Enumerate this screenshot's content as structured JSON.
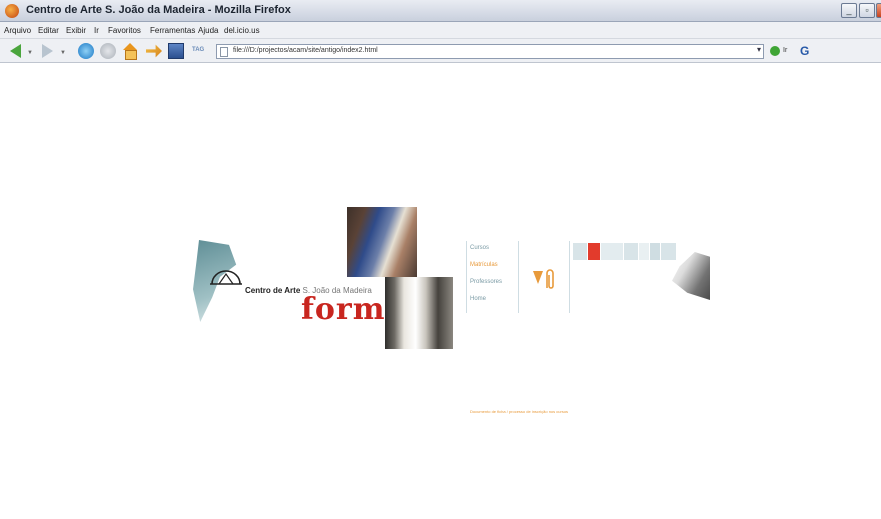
{
  "window": {
    "title": "Centro de Arte S. João da Madeira - Mozilla Firefox"
  },
  "menubar": {
    "items": [
      "Arquivo",
      "Editar",
      "Exibir",
      "Ir",
      "Favoritos",
      "Ferramentas",
      "Ajuda",
      "del.icio.us"
    ]
  },
  "navbar": {
    "tag_label": "TAG",
    "url": "file:///D:/projectos/acam/site/antigo/index2.html",
    "go_label": "Ir"
  },
  "page": {
    "logo_bold": "Centro de Arte",
    "logo_light": "S. João da Madeira",
    "headline": "formac",
    "menu": [
      "Cursos",
      "Matrículas",
      "Professores",
      "Home"
    ],
    "active_menu_index": 1,
    "footer": "Documento de ficha / processo de inscrição nos cursos",
    "colors": {
      "accent_orange": "#e89a3b",
      "accent_red": "#c8261f",
      "menu_teal": "#7a9aa4",
      "strip_light": "#d8e4e8",
      "strip_red": "#e23b2c"
    }
  }
}
